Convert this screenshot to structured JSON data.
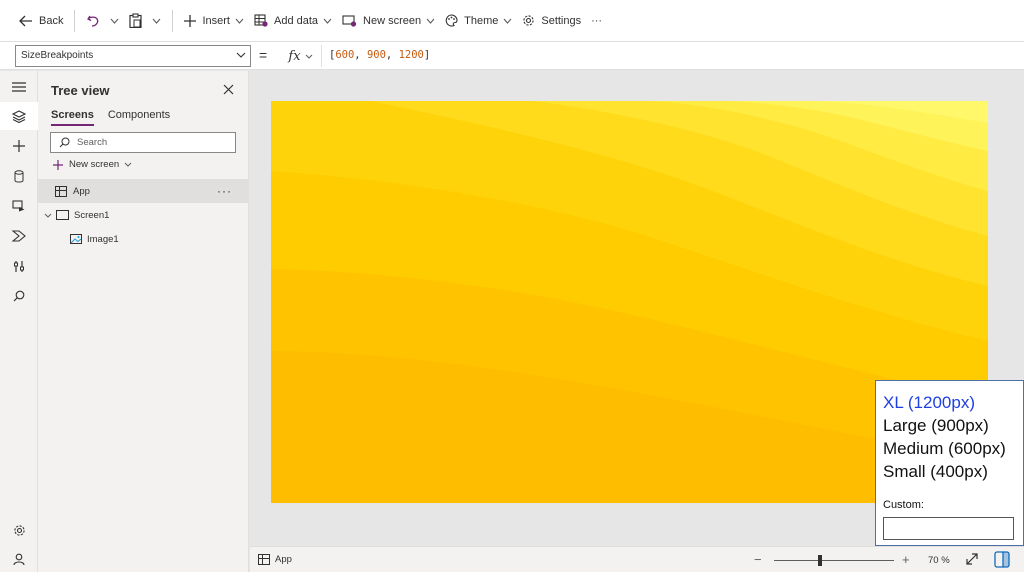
{
  "toolbar": {
    "back": "Back",
    "insert": "Insert",
    "add_data": "Add data",
    "new_screen": "New screen",
    "theme": "Theme",
    "settings": "Settings",
    "more": "···"
  },
  "formula_bar": {
    "property": "SizeBreakpoints",
    "equals": "=",
    "fx": "fx",
    "formula_open": "[",
    "values": [
      "600",
      "900",
      "1200"
    ],
    "formula_close": "]"
  },
  "tree": {
    "title": "Tree view",
    "tabs": [
      "Screens",
      "Components"
    ],
    "search_placeholder": "Search",
    "new_screen": "New screen",
    "nodes": [
      "App",
      "Screen1",
      "Image1"
    ],
    "more": "···"
  },
  "status_bar": {
    "app": "App",
    "zoom_minus": "−",
    "zoom_plus": "+",
    "zoom_value": "70  %",
    "zoom_percent": 70
  },
  "breakpoints": {
    "options": [
      "XL (1200px)",
      "Large (900px)",
      "Medium (600px)",
      "Small (400px)"
    ],
    "selected_index": 0,
    "custom_label": "Custom:",
    "custom_value": ""
  },
  "colors": {
    "accent": "#742774",
    "selected_breakpoint": "#1f3fe0",
    "canvas_light": "#fff86a",
    "canvas_dark": "#ffb300"
  },
  "icons": [
    "back-icon",
    "undo-icon",
    "paste-icon",
    "plus-icon",
    "table-icon",
    "new-screen-icon",
    "theme-icon",
    "gear-icon",
    "hamburger-icon",
    "layers-icon",
    "database-icon",
    "media-icon",
    "power-automate-icon",
    "tools-icon",
    "search-icon",
    "close-icon",
    "screen-icon",
    "image-icon",
    "expand-icon",
    "panel-icon",
    "account-icon"
  ]
}
